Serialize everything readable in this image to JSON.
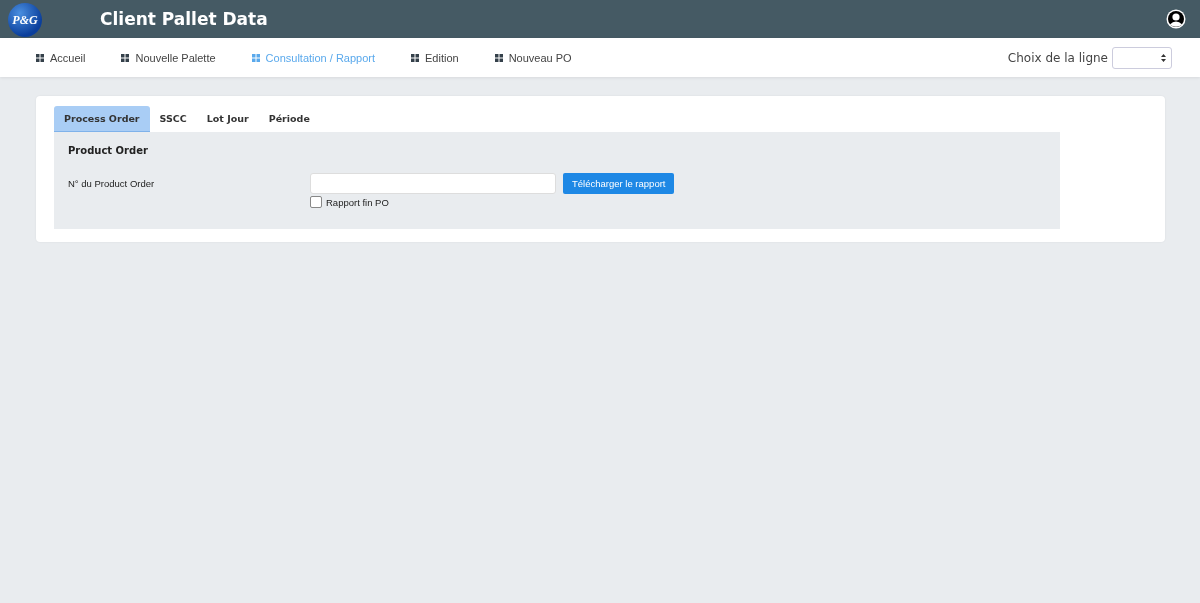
{
  "header": {
    "logo": "P&G",
    "title": "Client Pallet Data"
  },
  "nav": {
    "items": [
      {
        "label": "Accueil",
        "selected": false
      },
      {
        "label": "Nouvelle Palette",
        "selected": false
      },
      {
        "label": "Consultation / Rapport",
        "selected": true
      },
      {
        "label": "Edition",
        "selected": false
      },
      {
        "label": "Nouveau PO",
        "selected": false
      }
    ],
    "line_choice": {
      "label": "Choix de la ligne"
    }
  },
  "tabs": [
    {
      "label": "Process Order",
      "selected": true
    },
    {
      "label": "SSCC",
      "selected": false
    },
    {
      "label": "Lot Jour",
      "selected": false
    },
    {
      "label": "Période",
      "selected": false
    }
  ],
  "form": {
    "heading": "Product Order",
    "field_label": "N° du Product Order",
    "button": "Télécharger le rapport",
    "checkbox": {
      "label": "Rapport fin PO",
      "checked": false
    }
  }
}
